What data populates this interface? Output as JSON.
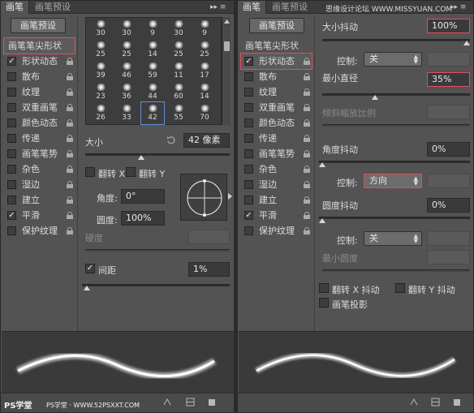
{
  "left": {
    "tabs": {
      "active": "画笔",
      "inactive": "画笔预设",
      "menu_glyph": "▸▸ ≡"
    },
    "presets_button": "画笔预设",
    "side_items": [
      {
        "label": "画笔笔尖形状",
        "checkbox": false,
        "header": true,
        "selected": true,
        "lock": false
      },
      {
        "label": "形状动态",
        "checkbox": true,
        "checked": true,
        "lock": true
      },
      {
        "label": "散布",
        "checkbox": true,
        "checked": false,
        "lock": true
      },
      {
        "label": "纹理",
        "checkbox": true,
        "checked": false,
        "lock": true
      },
      {
        "label": "双重画笔",
        "checkbox": true,
        "checked": false,
        "lock": true
      },
      {
        "label": "颜色动态",
        "checkbox": true,
        "checked": false,
        "lock": true
      },
      {
        "label": "传递",
        "checkbox": true,
        "checked": false,
        "lock": true
      },
      {
        "label": "画笔笔势",
        "checkbox": true,
        "checked": false,
        "lock": true
      },
      {
        "label": "杂色",
        "checkbox": true,
        "checked": false,
        "lock": true
      },
      {
        "label": "湿边",
        "checkbox": true,
        "checked": false,
        "lock": true
      },
      {
        "label": "建立",
        "checkbox": true,
        "checked": false,
        "lock": true
      },
      {
        "label": "平滑",
        "checkbox": true,
        "checked": true,
        "lock": true
      },
      {
        "label": "保护纹理",
        "checkbox": true,
        "checked": false,
        "lock": true
      }
    ],
    "brush_sizes": [
      [
        "30",
        "30",
        "9",
        "30",
        "9"
      ],
      [
        "25",
        "25",
        "14",
        "25",
        "25"
      ],
      [
        "39",
        "46",
        "59",
        "11",
        "17"
      ],
      [
        "23",
        "36",
        "44",
        "60",
        "14"
      ],
      [
        "26",
        "33",
        "42",
        "55",
        "70"
      ]
    ],
    "size": {
      "label": "大小",
      "value": "42 像素",
      "slider": 0.38
    },
    "flip_x": {
      "label": "翻转 X",
      "checked": false
    },
    "flip_y": {
      "label": "翻转 Y",
      "checked": false
    },
    "angle": {
      "label": "角度:",
      "value": "0°"
    },
    "roundness": {
      "label": "圆度:",
      "value": "100%"
    },
    "hardness": {
      "label": "硬度"
    },
    "spacing": {
      "label": "间距",
      "checked": true,
      "value": "1%",
      "slider": 0.01
    },
    "watermark": "PS学堂 · WWW.52PSXXT.COM",
    "logo_text": "PS学堂"
  },
  "right": {
    "tabs": {
      "active": "画笔",
      "inactive": "画笔预设",
      "menu_glyph": "▸▸ ≡"
    },
    "presets_button": "画笔预设",
    "header_watermark": "思缘设计论坛 WWW.MISSYUAN.COM",
    "side_items": [
      {
        "label": "画笔笔尖形状",
        "checkbox": false,
        "header": true,
        "selected": false,
        "lock": false
      },
      {
        "label": "形状动态",
        "checkbox": true,
        "checked": true,
        "lock": true,
        "selected": true
      },
      {
        "label": "散布",
        "checkbox": true,
        "checked": false,
        "lock": true
      },
      {
        "label": "纹理",
        "checkbox": true,
        "checked": false,
        "lock": true
      },
      {
        "label": "双重画笔",
        "checkbox": true,
        "checked": false,
        "lock": true
      },
      {
        "label": "颜色动态",
        "checkbox": true,
        "checked": false,
        "lock": true
      },
      {
        "label": "传递",
        "checkbox": true,
        "checked": false,
        "lock": true
      },
      {
        "label": "画笔笔势",
        "checkbox": true,
        "checked": false,
        "lock": true
      },
      {
        "label": "杂色",
        "checkbox": true,
        "checked": false,
        "lock": true
      },
      {
        "label": "湿边",
        "checkbox": true,
        "checked": false,
        "lock": true
      },
      {
        "label": "建立",
        "checkbox": true,
        "checked": false,
        "lock": true
      },
      {
        "label": "平滑",
        "checkbox": true,
        "checked": true,
        "lock": true
      },
      {
        "label": "保护纹理",
        "checkbox": true,
        "checked": false,
        "lock": true
      }
    ],
    "size_jitter": {
      "label": "大小抖动",
      "value": "100%",
      "slider": 1.0
    },
    "control1": {
      "label": "控制:",
      "value": "关"
    },
    "min_diameter": {
      "label": "最小直径",
      "value": "35%",
      "slider": 0.35
    },
    "tilt_scale": {
      "label": "倾斜缩放比例"
    },
    "angle_jitter": {
      "label": "角度抖动",
      "value": "0%",
      "slider": 0.0
    },
    "control2": {
      "label": "控制:",
      "value": "方向"
    },
    "roundness_jitter": {
      "label": "圆度抖动",
      "value": "0%",
      "slider": 0.0
    },
    "control3": {
      "label": "控制:",
      "value": "关"
    },
    "min_roundness": {
      "label": "最小圆度"
    },
    "flip_x_jitter": {
      "label": "翻转 X 抖动",
      "checked": false
    },
    "flip_y_jitter": {
      "label": "翻转 Y 抖动",
      "checked": false
    },
    "brush_projection": {
      "label": "画笔投影",
      "checked": false
    }
  },
  "colors": {
    "highlight": "#e84c5b",
    "selection": "#5e8fd6"
  }
}
